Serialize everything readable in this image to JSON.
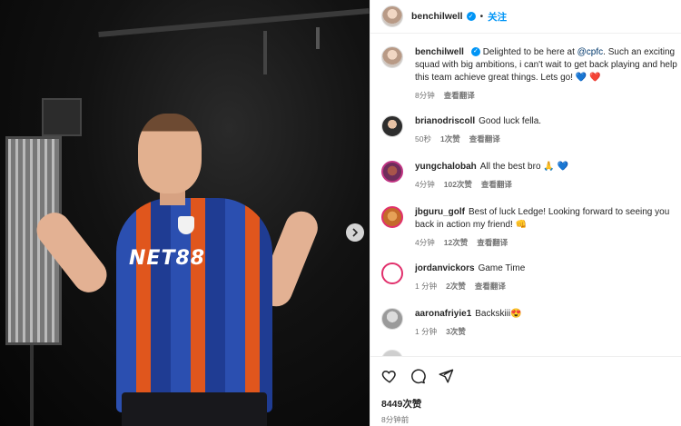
{
  "post": {
    "author": "benchilwell",
    "follow_label": "关注",
    "separator": "•"
  },
  "photo": {
    "jersey_sponsor": "NET88",
    "next_icon": "chevron-right-icon"
  },
  "caption": {
    "user": "benchilwell",
    "text_before": "Delighted to be here at ",
    "mention": "@cpfc",
    "text_after": ". Such an exciting squad with big ambitions, i can't wait to get back playing and help this team achieve great things. Lets go! ",
    "emoji": "💙 ❤️",
    "time": "8分钟",
    "translate": "查看翻译"
  },
  "comments": [
    {
      "user": "brianodriscoll",
      "text": "Good luck fella.",
      "time": "50秒",
      "likes": "1次赞",
      "translate": "查看翻译"
    },
    {
      "user": "yungchalobah",
      "text": "All the best bro 🙏 💙",
      "time": "4分钟",
      "likes": "102次赞",
      "translate": "查看翻译"
    },
    {
      "user": "jbguru_golf",
      "text": "Best of luck Ledge! Looking forward to seeing you back in action my friend! 👊",
      "time": "4分钟",
      "likes": "12次赞",
      "translate": "查看翻译"
    },
    {
      "user": "jordanvickors",
      "text": "Game Time",
      "time": "1 分钟",
      "likes": "2次赞",
      "translate": "查看翻译"
    },
    {
      "user": "aaronafriyie1",
      "text": "Backskiii😍",
      "time": "1 分钟",
      "likes": "3次赞",
      "translate": ""
    }
  ],
  "actions": {
    "like_icon": "heart-icon",
    "comment_icon": "comment-icon",
    "share_icon": "send-icon",
    "like_count": "8449次赞",
    "posted": "8分钟前"
  },
  "colors": {
    "link": "#0095f6",
    "mention": "#00376b",
    "muted": "#737373"
  }
}
